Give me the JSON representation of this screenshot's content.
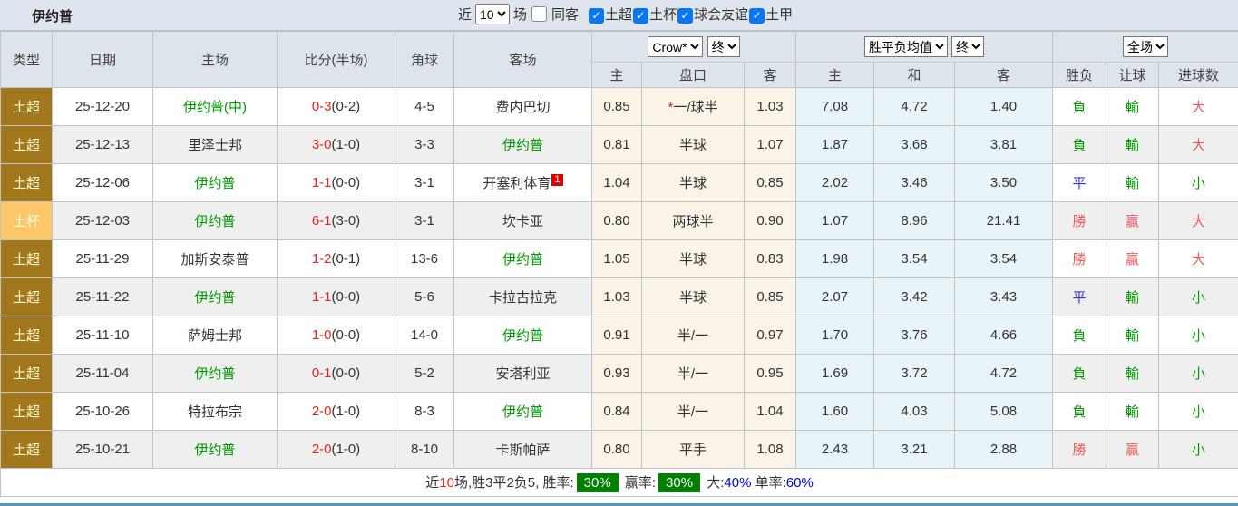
{
  "colors": {
    "self_team_green": "#009900",
    "score_red": "#ee2222",
    "result_red": "#e45c5c",
    "draw_blue": "#3333ee",
    "badge_green_bg": "#008000",
    "type_league_bg": "#a1781e",
    "type_cup_bg": "#fbc768",
    "bottom_line_blue": "#4e9ac4"
  },
  "topbar": {
    "title": "伊约普",
    "recent_label": "近",
    "recent_value": "10",
    "matches_label": "场",
    "same_away_label": "同客",
    "same_away_checked": false,
    "leagues": [
      {
        "label": "土超",
        "checked": true
      },
      {
        "label": "土杯",
        "checked": true
      },
      {
        "label": "球会友谊",
        "checked": true
      },
      {
        "label": "土甲",
        "checked": true
      }
    ]
  },
  "table": {
    "columns": [
      "类型",
      "日期",
      "主场",
      "比分(半场)",
      "角球",
      "客场"
    ],
    "selects": {
      "bookmaker": "Crow*",
      "bookmaker_status": "终",
      "avg": "胜平负均值",
      "avg_status": "终",
      "scope": "全场"
    },
    "subheaders": [
      "主",
      "盘口",
      "客",
      "主",
      "和",
      "客",
      "胜负",
      "让球",
      "进球数"
    ],
    "rows": [
      {
        "type": "土超",
        "cup": false,
        "date": "25-12-20",
        "home": "伊约普(中)",
        "home_green": true,
        "score": "0-3",
        "half": "(0-2)",
        "corners": "4-5",
        "away": "费内巴切",
        "away_green": false,
        "away_badge": "",
        "odds_home": "0.85",
        "handicap_star": true,
        "handicap": "一/球半",
        "odds_away": "1.03",
        "avg_home": "7.08",
        "avg_draw": "4.72",
        "avg_away": "1.40",
        "result": "負",
        "result_color": "green",
        "handicap_result": "輸",
        "handicap_result_color": "green",
        "goals": "大",
        "goals_color": "red"
      },
      {
        "type": "土超",
        "cup": false,
        "date": "25-12-13",
        "home": "里泽士邦",
        "home_green": false,
        "score": "3-0",
        "half": "(1-0)",
        "corners": "3-3",
        "away": "伊约普",
        "away_green": true,
        "away_badge": "",
        "odds_home": "0.81",
        "handicap_star": false,
        "handicap": "半球",
        "odds_away": "1.07",
        "avg_home": "1.87",
        "avg_draw": "3.68",
        "avg_away": "3.81",
        "result": "負",
        "result_color": "green",
        "handicap_result": "輸",
        "handicap_result_color": "green",
        "goals": "大",
        "goals_color": "red"
      },
      {
        "type": "土超",
        "cup": false,
        "date": "25-12-06",
        "home": "伊约普",
        "home_green": true,
        "score": "1-1",
        "half": "(0-0)",
        "corners": "3-1",
        "away": "开塞利体育",
        "away_green": false,
        "away_badge": "1",
        "odds_home": "1.04",
        "handicap_star": false,
        "handicap": "半球",
        "odds_away": "0.85",
        "avg_home": "2.02",
        "avg_draw": "3.46",
        "avg_away": "3.50",
        "result": "平",
        "result_color": "blue",
        "handicap_result": "輸",
        "handicap_result_color": "green",
        "goals": "小",
        "goals_color": "green"
      },
      {
        "type": "土杯",
        "cup": true,
        "date": "25-12-03",
        "home": "伊约普",
        "home_green": true,
        "score": "6-1",
        "half": "(3-0)",
        "corners": "3-1",
        "away": "坎卡亚",
        "away_green": false,
        "away_badge": "",
        "odds_home": "0.80",
        "handicap_star": false,
        "handicap": "两球半",
        "odds_away": "0.90",
        "avg_home": "1.07",
        "avg_draw": "8.96",
        "avg_away": "21.41",
        "result": "勝",
        "result_color": "red",
        "handicap_result": "贏",
        "handicap_result_color": "red",
        "goals": "大",
        "goals_color": "red"
      },
      {
        "type": "土超",
        "cup": false,
        "date": "25-11-29",
        "home": "加斯安泰普",
        "home_green": false,
        "score": "1-2",
        "half": "(0-1)",
        "corners": "13-6",
        "away": "伊约普",
        "away_green": true,
        "away_badge": "",
        "odds_home": "1.05",
        "handicap_star": false,
        "handicap": "半球",
        "odds_away": "0.83",
        "avg_home": "1.98",
        "avg_draw": "3.54",
        "avg_away": "3.54",
        "result": "勝",
        "result_color": "red",
        "handicap_result": "贏",
        "handicap_result_color": "red",
        "goals": "大",
        "goals_color": "red"
      },
      {
        "type": "土超",
        "cup": false,
        "date": "25-11-22",
        "home": "伊约普",
        "home_green": true,
        "score": "1-1",
        "half": "(0-0)",
        "corners": "5-6",
        "away": "卡拉古拉克",
        "away_green": false,
        "away_badge": "",
        "odds_home": "1.03",
        "handicap_star": false,
        "handicap": "半球",
        "odds_away": "0.85",
        "avg_home": "2.07",
        "avg_draw": "3.42",
        "avg_away": "3.43",
        "result": "平",
        "result_color": "blue",
        "handicap_result": "輸",
        "handicap_result_color": "green",
        "goals": "小",
        "goals_color": "green"
      },
      {
        "type": "土超",
        "cup": false,
        "date": "25-11-10",
        "home": "萨姆士邦",
        "home_green": false,
        "score": "1-0",
        "half": "(0-0)",
        "corners": "14-0",
        "away": "伊约普",
        "away_green": true,
        "away_badge": "",
        "odds_home": "0.91",
        "handicap_star": false,
        "handicap": "半/一",
        "odds_away": "0.97",
        "avg_home": "1.70",
        "avg_draw": "3.76",
        "avg_away": "4.66",
        "result": "負",
        "result_color": "green",
        "handicap_result": "輸",
        "handicap_result_color": "green",
        "goals": "小",
        "goals_color": "green"
      },
      {
        "type": "土超",
        "cup": false,
        "date": "25-11-04",
        "home": "伊约普",
        "home_green": true,
        "score": "0-1",
        "half": "(0-0)",
        "corners": "5-2",
        "away": "安塔利亚",
        "away_green": false,
        "away_badge": "",
        "odds_home": "0.93",
        "handicap_star": false,
        "handicap": "半/一",
        "odds_away": "0.95",
        "avg_home": "1.69",
        "avg_draw": "3.72",
        "avg_away": "4.72",
        "result": "負",
        "result_color": "green",
        "handicap_result": "輸",
        "handicap_result_color": "green",
        "goals": "小",
        "goals_color": "green"
      },
      {
        "type": "土超",
        "cup": false,
        "date": "25-10-26",
        "home": "特拉布宗",
        "home_green": false,
        "score": "2-0",
        "half": "(1-0)",
        "corners": "8-3",
        "away": "伊约普",
        "away_green": true,
        "away_badge": "",
        "odds_home": "0.84",
        "handicap_star": false,
        "handicap": "半/一",
        "odds_away": "1.04",
        "avg_home": "1.60",
        "avg_draw": "4.03",
        "avg_away": "5.08",
        "result": "負",
        "result_color": "green",
        "handicap_result": "輸",
        "handicap_result_color": "green",
        "goals": "小",
        "goals_color": "green"
      },
      {
        "type": "土超",
        "cup": false,
        "date": "25-10-21",
        "home": "伊约普",
        "home_green": true,
        "score": "2-0",
        "half": "(1-0)",
        "corners": "8-10",
        "away": "卡斯帕萨",
        "away_green": false,
        "away_badge": "",
        "odds_home": "0.80",
        "handicap_star": false,
        "handicap": "平手",
        "odds_away": "1.08",
        "avg_home": "2.43",
        "avg_draw": "3.21",
        "avg_away": "2.88",
        "result": "勝",
        "result_color": "red",
        "handicap_result": "贏",
        "handicap_result_color": "red",
        "goals": "小",
        "goals_color": "green"
      }
    ]
  },
  "summary": {
    "segments": [
      {
        "text": "近",
        "style": "plain"
      },
      {
        "text": "10",
        "style": "red"
      },
      {
        "text": "场,胜3平2负5, 胜率:",
        "style": "plain"
      },
      {
        "text": "30%",
        "style": "badge"
      },
      {
        "text": " 赢率:",
        "style": "plain"
      },
      {
        "text": "30%",
        "style": "badge"
      },
      {
        "text": " 大:",
        "style": "plain"
      },
      {
        "text": "40%",
        "style": "blue"
      },
      {
        "text": " 单率:",
        "style": "plain"
      },
      {
        "text": "60%",
        "style": "blue"
      }
    ]
  }
}
